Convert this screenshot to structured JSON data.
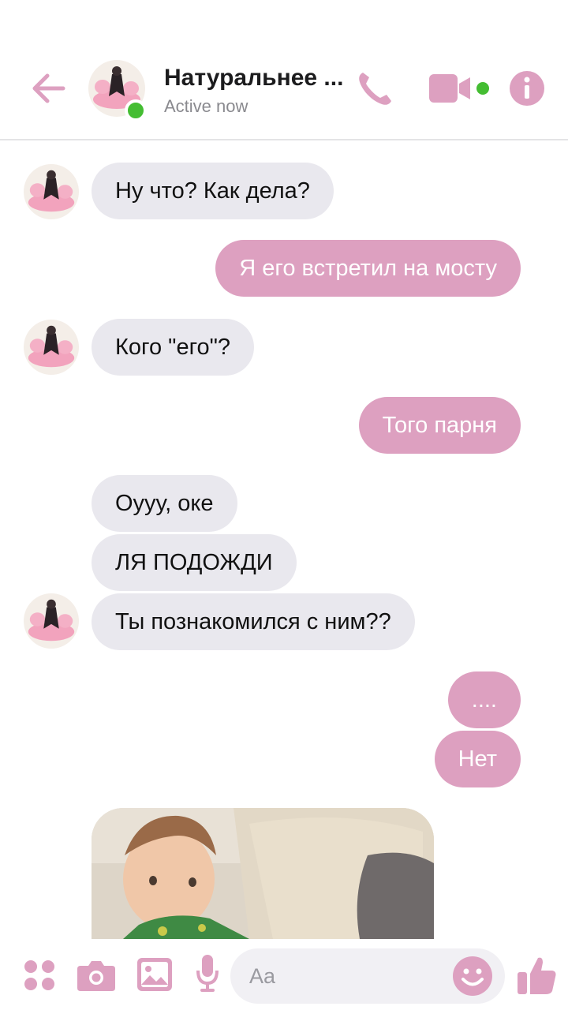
{
  "header": {
    "title": "Натуральнее ...",
    "status": "Active now"
  },
  "messages": [
    {
      "from": "them",
      "text": "Ну что? Как дела?"
    },
    {
      "from": "me",
      "text": "Я его встретил на мосту"
    },
    {
      "from": "them",
      "text": "Кого \"его\"?"
    },
    {
      "from": "me",
      "text": "Того парня"
    },
    {
      "from": "them",
      "text": "Оууу, оке"
    },
    {
      "from": "them",
      "text": "ЛЯ ПОДОЖДИ"
    },
    {
      "from": "them",
      "text": "Ты познакомился с ним??"
    },
    {
      "from": "me",
      "text": "...."
    },
    {
      "from": "me",
      "text": "Нет"
    },
    {
      "from": "them",
      "type": "photo"
    }
  ],
  "composer": {
    "placeholder": "Aa"
  },
  "colors": {
    "accent": "#dda0c0",
    "incoming_bubble": "#e9e8ee",
    "online": "#44bd32"
  },
  "icons": {
    "header": [
      "back-arrow-icon",
      "phone-icon",
      "video-camera-icon",
      "info-icon"
    ],
    "composer": [
      "apps-grid-icon",
      "camera-icon",
      "gallery-icon",
      "microphone-icon",
      "emoji-icon",
      "like-icon"
    ]
  }
}
